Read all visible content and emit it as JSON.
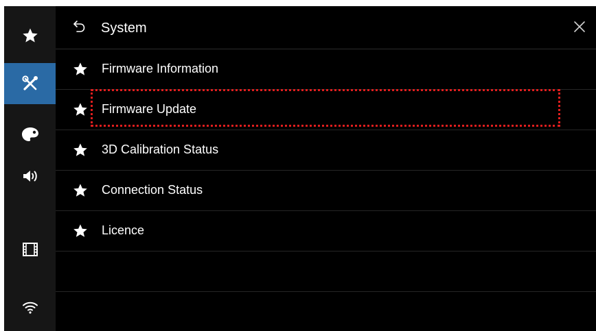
{
  "header": {
    "title": "System",
    "back_icon": "back-arrow-icon",
    "close_icon": "close-icon"
  },
  "sidebar": {
    "items": [
      {
        "icon": "star-icon",
        "active": false
      },
      {
        "icon": "tools-icon",
        "active": true
      },
      {
        "icon": "palette-icon",
        "active": false
      },
      {
        "icon": "speaker-icon",
        "active": false
      },
      {
        "icon": "film-icon",
        "active": false
      },
      {
        "icon": "wifi-icon",
        "active": false
      }
    ]
  },
  "menu": {
    "items": [
      {
        "label": "Firmware Information",
        "icon": "star-icon"
      },
      {
        "label": "Firmware Update",
        "icon": "star-icon",
        "highlighted": true
      },
      {
        "label": "3D Calibration Status",
        "icon": "star-icon"
      },
      {
        "label": "Connection Status",
        "icon": "star-icon"
      },
      {
        "label": "Licence",
        "icon": "star-icon"
      }
    ]
  },
  "colors": {
    "accent": "#2a6aa5",
    "background": "#000000",
    "sidebar": "#161616",
    "highlight": "#e01e1e"
  }
}
